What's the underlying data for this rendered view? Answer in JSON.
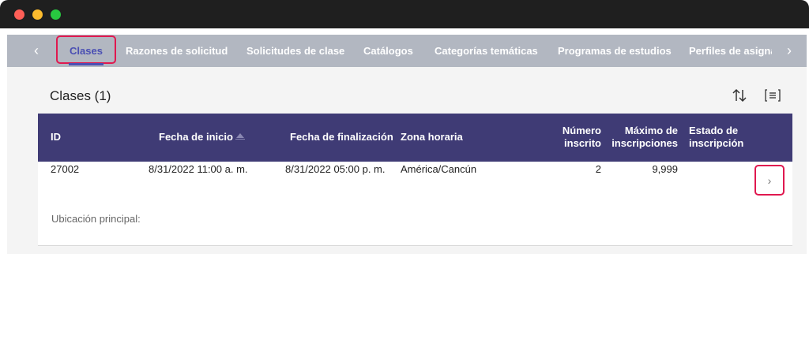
{
  "tabs": {
    "items": [
      {
        "label": "Clases",
        "active": true
      },
      {
        "label": "Razones de solicitud"
      },
      {
        "label": "Solicitudes de clase"
      },
      {
        "label": "Catálogos"
      },
      {
        "label": "Categorías temáticas"
      },
      {
        "label": "Programas de estudios"
      },
      {
        "label": "Perfiles de asignación"
      }
    ],
    "prev_icon": "‹",
    "next_icon": "›"
  },
  "section": {
    "title": "Clases (1)"
  },
  "table": {
    "headers": {
      "id": "ID",
      "start": "Fecha de inicio",
      "end": "Fecha de finalización",
      "tz": "Zona horaria",
      "enrolled_1": "Número",
      "enrolled_2": "inscrito",
      "max_1": "Máximo de",
      "max_2": "inscripciones",
      "status_1": "Estado de",
      "status_2": "inscripción"
    },
    "rows": [
      {
        "id": "27002",
        "start": "8/31/2022 11:00 a. m.",
        "end": "8/31/2022 05:00 p. m.",
        "tz": "América/Cancún",
        "enrolled": "2",
        "max": "9,999",
        "status": "",
        "chevron": "›"
      }
    ],
    "location_label": "Ubicación principal:"
  },
  "colors": {
    "header_bg": "#3f3b75",
    "tabbar_bg": "#b2b7c1",
    "accent": "#4a4fb3",
    "highlight": "#e0184f"
  }
}
